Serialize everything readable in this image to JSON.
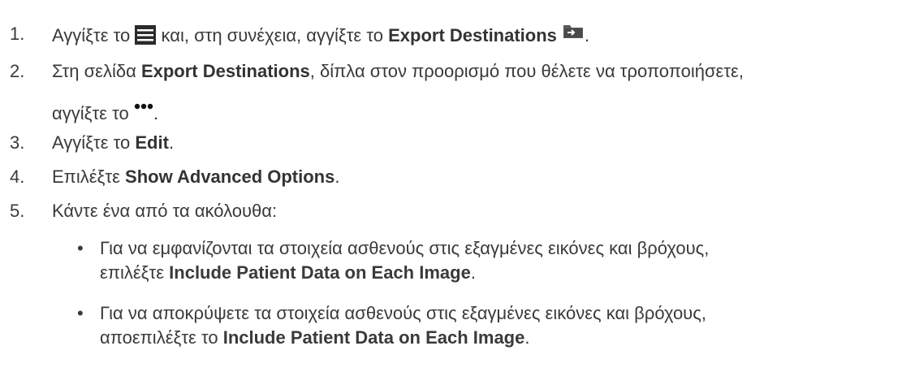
{
  "steps": [
    {
      "number": "1.",
      "text_a": "Αγγίξτε το",
      "icon_a": "menu-icon",
      "text_b": "και, στη συνέχεια, αγγίξτε το",
      "bold_a": "Export Destinations",
      "icon_b": "export-destinations-icon",
      "text_c": "."
    },
    {
      "number": "2.",
      "text_a": "Στη σελίδα",
      "bold_a": "Export Destinations",
      "text_b": ", δίπλα στον προορισμό που θέλετε να τροποποιήσετε,",
      "line2_text": "αγγίξτε το",
      "icon_a": "more-options-icon",
      "line2_end": "."
    },
    {
      "number": "3.",
      "text_a": "Αγγίξτε το",
      "bold_a": "Edit",
      "text_b": "."
    },
    {
      "number": "4.",
      "text_a": "Επιλέξτε",
      "bold_a": "Show Advanced Options",
      "text_b": "."
    },
    {
      "number": "5.",
      "text_a": "Κάντε ένα από τα ακόλουθα:"
    }
  ],
  "bullets": [
    {
      "dot": "•",
      "line1": "Για να εμφανίζονται τα στοιχεία ασθενούς στις εξαγμένες εικόνες και βρόχους,",
      "line2_text": "επιλέξτε",
      "line2_bold": "Include Patient Data on Each Image",
      "line2_end": "."
    },
    {
      "dot": "•",
      "line1": "Για να αποκρύψετε τα στοιχεία ασθενούς στις εξαγμένες εικόνες και βρόχους,",
      "line2_text": "αποεπιλέξτε το",
      "line2_bold": "Include Patient Data on Each Image",
      "line2_end": "."
    }
  ]
}
